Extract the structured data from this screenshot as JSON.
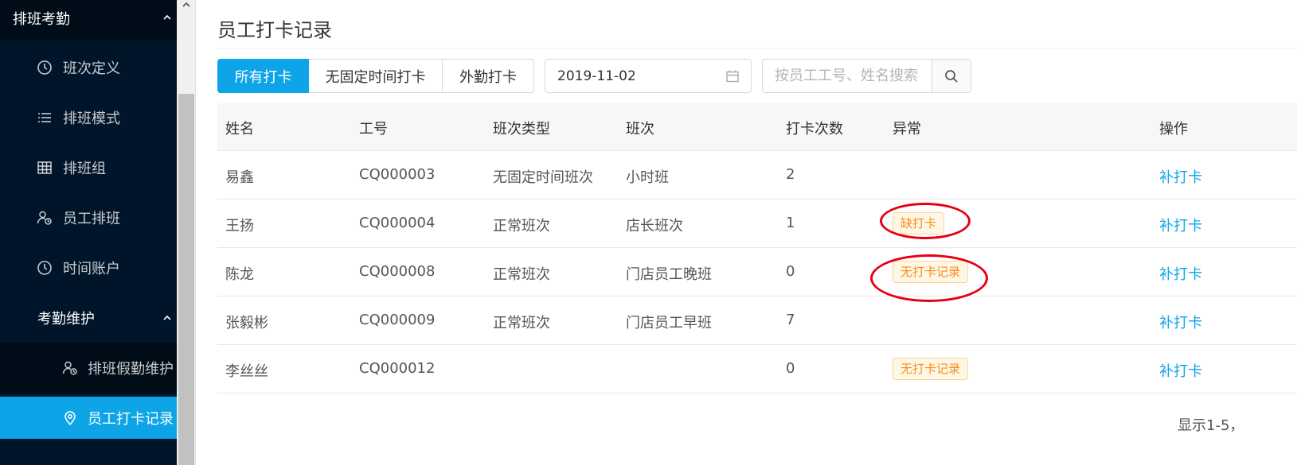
{
  "sidebar": {
    "group_label": "排班考勤",
    "items": [
      {
        "label": "班次定义",
        "icon": "clock-icon"
      },
      {
        "label": "排班模式",
        "icon": "list-icon"
      },
      {
        "label": "排班组",
        "icon": "table-icon"
      },
      {
        "label": "员工排班",
        "icon": "user-calendar-icon"
      },
      {
        "label": "时间账户",
        "icon": "clock-icon"
      }
    ],
    "subgroup_label": "考勤维护",
    "sub_items": [
      {
        "label": "排班假勤维护",
        "icon": "user-calendar-icon",
        "active": false
      },
      {
        "label": "员工打卡记录",
        "icon": "location-pin-icon",
        "active": true
      }
    ]
  },
  "page": {
    "title": "员工打卡记录"
  },
  "tabs": [
    {
      "label": "所有打卡",
      "active": true
    },
    {
      "label": "无固定时间打卡",
      "active": false
    },
    {
      "label": "外勤打卡",
      "active": false
    }
  ],
  "date_picker": {
    "value": "2019-11-02",
    "icon": "calendar-icon"
  },
  "search": {
    "placeholder": "按员工工号、姓名搜索",
    "icon": "search-icon"
  },
  "table": {
    "headers": [
      "姓名",
      "工号",
      "班次类型",
      "班次",
      "打卡次数",
      "异常",
      "操作"
    ],
    "rows": [
      {
        "name": "易鑫",
        "id": "CQ000003",
        "shift_type": "无固定时间班次",
        "shift": "小时班",
        "count": "2",
        "abnormal": "",
        "action": "补打卡"
      },
      {
        "name": "王扬",
        "id": "CQ000004",
        "shift_type": "正常班次",
        "shift": "店长班次",
        "count": "1",
        "abnormal": "缺打卡",
        "action": "补打卡"
      },
      {
        "name": "陈龙",
        "id": "CQ000008",
        "shift_type": "正常班次",
        "shift": "门店员工晚班",
        "count": "0",
        "abnormal": "无打卡记录",
        "action": "补打卡"
      },
      {
        "name": "张毅彬",
        "id": "CQ000009",
        "shift_type": "正常班次",
        "shift": "门店员工早班",
        "count": "7",
        "abnormal": "",
        "action": "补打卡"
      },
      {
        "name": "李丝丝",
        "id": "CQ000012",
        "shift_type": "",
        "shift": "",
        "count": "0",
        "abnormal": "无打卡记录",
        "action": "补打卡"
      }
    ]
  },
  "pagination": {
    "summary": "显示1-5，"
  },
  "colors": {
    "sidebar_bg": "#001529",
    "sidebar_group_bg": "#000c17",
    "accent": "#0ea4e8",
    "badge_text": "#fa8c16",
    "badge_bg": "#fff7e6",
    "annotation_red": "#e60012"
  }
}
